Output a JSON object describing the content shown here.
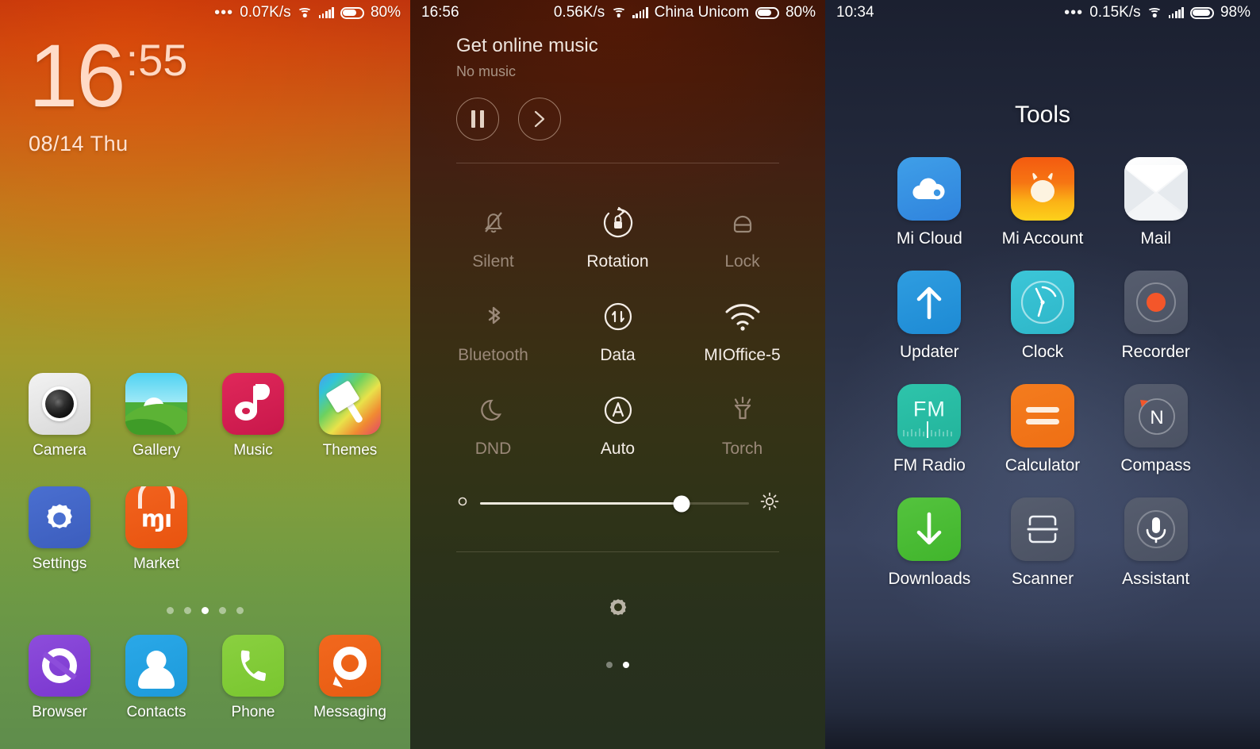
{
  "home": {
    "status": {
      "dots_icon": "more-dots-icon",
      "speed": "0.07K/s",
      "wifi_icon": "wifi-icon",
      "signal_icon": "signal-bars-icon",
      "battery_icon": "battery-icon",
      "battery_pct": "80%"
    },
    "clock": {
      "hours": "16",
      "minutes": ":55",
      "date": "08/14  Thu"
    },
    "rows": [
      [
        {
          "label": "Camera",
          "icon": "camera-icon"
        },
        {
          "label": "Gallery",
          "icon": "gallery-icon"
        },
        {
          "label": "Music",
          "icon": "music-icon"
        },
        {
          "label": "Themes",
          "icon": "themes-icon"
        }
      ],
      [
        {
          "label": "Settings",
          "icon": "settings-icon"
        },
        {
          "label": "Market",
          "icon": "market-icon"
        }
      ]
    ],
    "dock": [
      {
        "label": "Browser",
        "icon": "browser-icon"
      },
      {
        "label": "Contacts",
        "icon": "contacts-icon"
      },
      {
        "label": "Phone",
        "icon": "phone-icon"
      },
      {
        "label": "Messaging",
        "icon": "messaging-icon"
      }
    ],
    "page_dots": {
      "count": 5,
      "active": 3
    }
  },
  "control_center": {
    "status": {
      "time": "16:56",
      "speed": "0.56K/s",
      "wifi_icon": "wifi-icon",
      "signal_icon": "signal-bars-icon",
      "carrier": "China Unicom",
      "battery_icon": "battery-icon",
      "battery_pct": "80%"
    },
    "music": {
      "title": "Get online music",
      "subtitle": "No music",
      "pause_label": "pause-button",
      "next_label": "next-button"
    },
    "toggles": [
      {
        "label": "Silent",
        "icon": "bell-slash-icon",
        "state": "off"
      },
      {
        "label": "Rotation",
        "icon": "rotation-lock-icon",
        "state": "on"
      },
      {
        "label": "Lock",
        "icon": "lock-icon",
        "state": "off"
      },
      {
        "label": "Bluetooth",
        "icon": "bluetooth-icon",
        "state": "off"
      },
      {
        "label": "Data",
        "icon": "mobile-data-icon",
        "state": "on"
      },
      {
        "label": "MIOffice-5",
        "icon": "wifi-icon",
        "state": "on"
      },
      {
        "label": "DND",
        "icon": "moon-icon",
        "state": "off"
      },
      {
        "label": "Auto",
        "icon": "auto-brightness-icon",
        "state": "on"
      },
      {
        "label": "Torch",
        "icon": "torch-icon",
        "state": "off"
      }
    ],
    "brightness": {
      "low_icon": "brightness-low-icon",
      "high_icon": "brightness-high-icon",
      "value": 75
    },
    "settings_icon": "gear-icon",
    "page_dots": {
      "count": 2,
      "active": 2
    }
  },
  "tools": {
    "status": {
      "time": "10:34",
      "dots_icon": "more-dots-icon",
      "speed": "0.15K/s",
      "wifi_icon": "wifi-icon",
      "signal_icon": "signal-bars-icon",
      "battery_icon": "battery-icon",
      "battery_pct": "98%"
    },
    "title": "Tools",
    "apps": [
      {
        "label": "Mi Cloud",
        "icon": "mi-cloud-icon"
      },
      {
        "label": "Mi Account",
        "icon": "mi-account-icon"
      },
      {
        "label": "Mail",
        "icon": "mail-icon"
      },
      {
        "label": "Updater",
        "icon": "updater-icon"
      },
      {
        "label": "Clock",
        "icon": "clock-icon"
      },
      {
        "label": "Recorder",
        "icon": "recorder-icon"
      },
      {
        "label": "FM Radio",
        "icon": "fm-radio-icon",
        "glyph": "FM"
      },
      {
        "label": "Calculator",
        "icon": "calculator-icon"
      },
      {
        "label": "Compass",
        "icon": "compass-icon",
        "glyph": "N"
      },
      {
        "label": "Downloads",
        "icon": "downloads-icon"
      },
      {
        "label": "Scanner",
        "icon": "scanner-icon"
      },
      {
        "label": "Assistant",
        "icon": "assistant-icon"
      }
    ]
  },
  "colors": {
    "home_top": "#c0340d",
    "home_bottom": "#5f8d4c",
    "cc_top": "#3b1408",
    "cc_bottom": "#26301f",
    "tools_bg": "#2b3349",
    "accent_white": "#ffffff"
  }
}
